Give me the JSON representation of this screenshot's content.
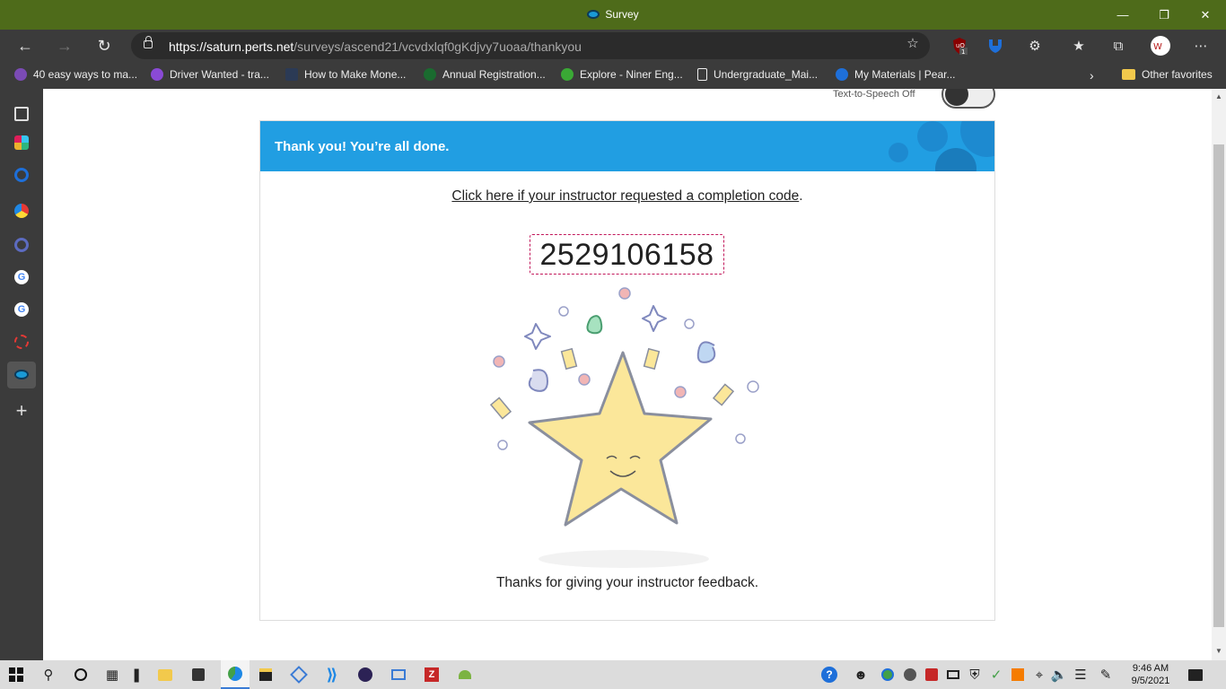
{
  "window": {
    "title": "Survey"
  },
  "address": {
    "url_host": "https://saturn.perts.net",
    "url_path": "/surveys/ascend21/vcvdxlqf0gKdjvy7uoaa/thankyou"
  },
  "toolbar": {
    "extension_badge": "1"
  },
  "bookmarks": [
    {
      "label": "40 easy ways to ma...",
      "color": "#7b4bb5"
    },
    {
      "label": "Driver Wanted - tra...",
      "color": "#8a4ad6"
    },
    {
      "label": "How to Make Mone...",
      "color": "#2b3a55"
    },
    {
      "label": "Annual Registration...",
      "color": "#1a6b2f"
    },
    {
      "label": "Explore - Niner Eng...",
      "color": "#3aa935"
    },
    {
      "label": "Undergraduate_Mai...",
      "color": "#eeeeee"
    },
    {
      "label": "My Materials | Pear...",
      "color": "#1e6fd9"
    }
  ],
  "bookmarks_other": "Other favorites",
  "page": {
    "tts_label": "Text-to-Speech Off",
    "header_title": "Thank you! You’re all done.",
    "link_text": "Click here if your instructor requested a completion code",
    "link_suffix": ".",
    "completion_code": "2529106158",
    "thanks_text": "Thanks for giving your instructor feedback."
  },
  "taskbar": {
    "time": "9:46 AM",
    "date": "9/5/2021"
  },
  "colors": {
    "header_blue": "#219ee2",
    "titlebar_green": "#4e6b1a",
    "code_border": "#c2185b",
    "star_fill": "#fbe79a"
  }
}
